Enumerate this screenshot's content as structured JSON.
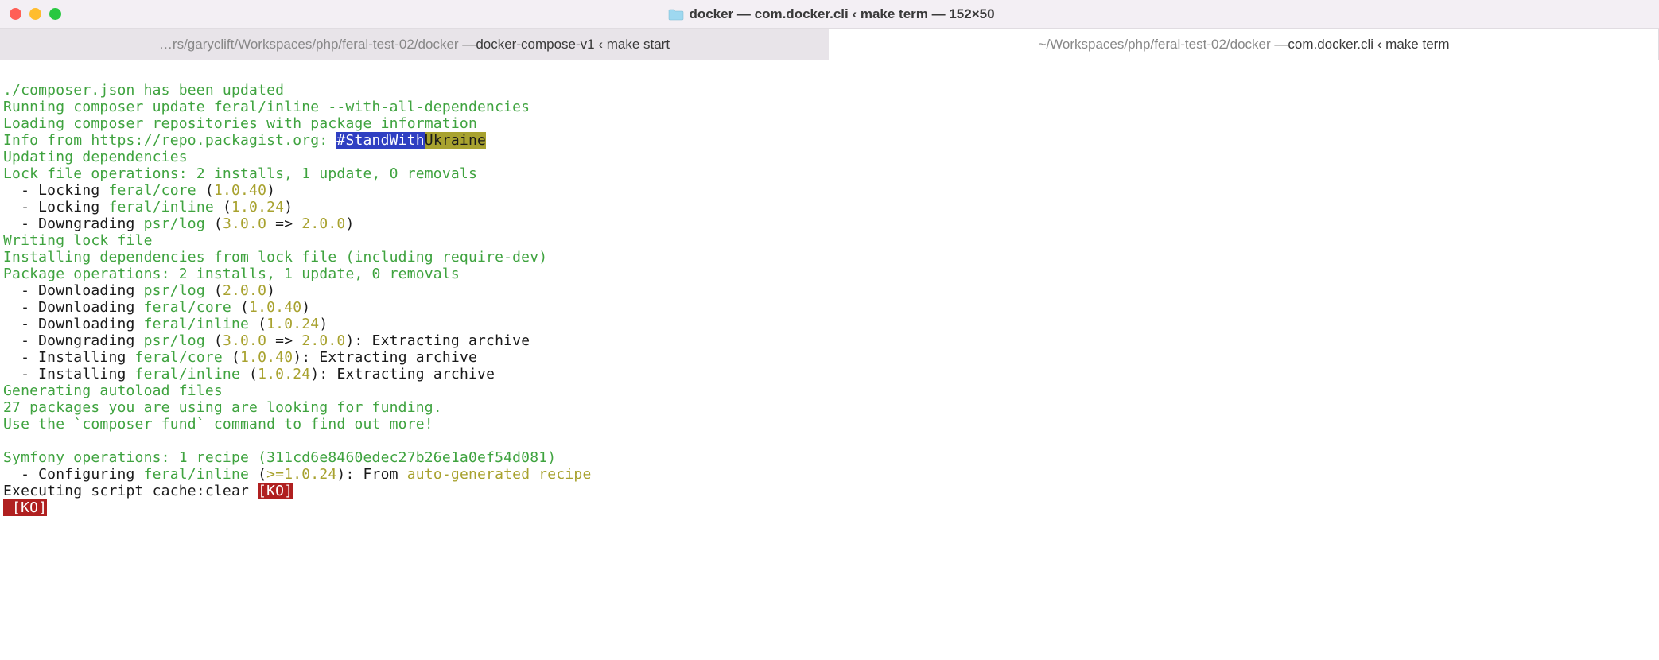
{
  "window": {
    "title": "docker — com.docker.cli ‹ make term — 152×50"
  },
  "tabs": [
    {
      "prefix": "…rs/garyclift/Workspaces/php/feral-test-02/docker — ",
      "main": "docker-compose-v1 ‹ make start",
      "active": true
    },
    {
      "prefix": "~/Workspaces/php/feral-test-02/docker — ",
      "main": "com.docker.cli ‹ make term",
      "active": false
    }
  ],
  "term": {
    "l1": "./composer.json has been updated",
    "l2": "Running composer update feral/inline --with-all-dependencies",
    "l3": "Loading composer repositories with package information",
    "l4a": "Info from https://repo.packagist.org: ",
    "l4b": "#StandWith",
    "l4c": "Ukraine",
    "l5": "Updating dependencies",
    "l6": "Lock file operations: 2 installs, 1 update, 0 removals",
    "l7a": "  - Locking ",
    "l7b": "feral/core",
    "l7c": " (",
    "l7d": "1.0.40",
    "l7e": ")",
    "l8a": "  - Locking ",
    "l8b": "feral/inline",
    "l8c": " (",
    "l8d": "1.0.24",
    "l8e": ")",
    "l9a": "  - Downgrading ",
    "l9b": "psr/log",
    "l9c": " (",
    "l9d": "3.0.0",
    "l9e": " => ",
    "l9f": "2.0.0",
    "l9g": ")",
    "l10": "Writing lock file",
    "l11": "Installing dependencies from lock file (including require-dev)",
    "l12": "Package operations: 2 installs, 1 update, 0 removals",
    "l13a": "  - Downloading ",
    "l13b": "psr/log",
    "l13c": " (",
    "l13d": "2.0.0",
    "l13e": ")",
    "l14a": "  - Downloading ",
    "l14b": "feral/core",
    "l14c": " (",
    "l14d": "1.0.40",
    "l14e": ")",
    "l15a": "  - Downloading ",
    "l15b": "feral/inline",
    "l15c": " (",
    "l15d": "1.0.24",
    "l15e": ")",
    "l16a": "  - Downgrading ",
    "l16b": "psr/log",
    "l16c": " (",
    "l16d": "3.0.0",
    "l16e": " => ",
    "l16f": "2.0.0",
    "l16g": "): Extracting archive",
    "l17a": "  - Installing ",
    "l17b": "feral/core",
    "l17c": " (",
    "l17d": "1.0.40",
    "l17e": "): Extracting archive",
    "l18a": "  - Installing ",
    "l18b": "feral/inline",
    "l18c": " (",
    "l18d": "1.0.24",
    "l18e": "): Extracting archive",
    "l19": "Generating autoload files",
    "l20": "27 packages you are using are looking for funding.",
    "l21": "Use the `composer fund` command to find out more!",
    "l22": "",
    "l23": "Symfony operations: 1 recipe (311cd6e8460edec27b26e1a0ef54d081)",
    "l24a": "  - Configuring ",
    "l24b": "feral/inline",
    "l24c": " (",
    "l24d": ">=1.0.24",
    "l24e": "): From ",
    "l24f": "auto-generated recipe",
    "l25a": "Executing script cache:clear ",
    "l25b": "[KO]",
    "l26": " [KO]"
  }
}
